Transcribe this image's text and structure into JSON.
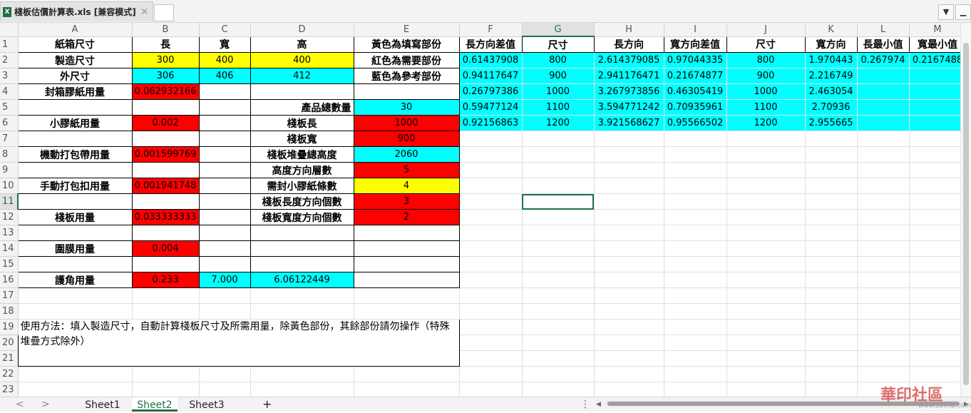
{
  "window": {
    "file_tab": "棧板估價計算表.xls  [兼容模式]",
    "file_icon": "excel-file-icon",
    "close_glyph": "✕",
    "menu_glyph": "▼",
    "minimize_glyph": "▁"
  },
  "columns": [
    "A",
    "B",
    "C",
    "D",
    "E",
    "F",
    "G",
    "H",
    "I",
    "J",
    "K",
    "L",
    "M"
  ],
  "rows": [
    "1",
    "2",
    "3",
    "4",
    "5",
    "6",
    "7",
    "8",
    "9",
    "10",
    "11",
    "12",
    "13",
    "14",
    "15",
    "16",
    "17",
    "18",
    "19",
    "20",
    "21",
    "22",
    "23"
  ],
  "selected_cell": "G11",
  "cells": {
    "A1": "紙箱尺寸",
    "B1": "長",
    "C1": "寬",
    "D1": "高",
    "E1": "黃色為填寫部份",
    "F1": "長方向差值",
    "G1": "尺寸",
    "H1": "長方向",
    "I1": "寬方向差值",
    "J1": "尺寸",
    "K1": "寬方向",
    "L1": "長最小值",
    "M1": "寬最小值",
    "A2": "製造尺寸",
    "B2": "300",
    "C2": "400",
    "D2": "400",
    "E2": "紅色為需要部份",
    "F2": "0.61437908",
    "G2": "800",
    "H2": "2.614379085",
    "I2": "0.97044335",
    "J2": "800",
    "K2": "1.970443",
    "L2": "0.267974",
    "M2": "0.2167488",
    "A3": "外尺寸",
    "B3": "306",
    "C3": "406",
    "D3": "412",
    "E3": "藍色為參考部份",
    "F3": "0.94117647",
    "G3": "900",
    "H3": "2.941176471",
    "I3": "0.21674877",
    "J3": "900",
    "K3": "2.216749",
    "A4": "封箱膠紙用量",
    "B4": "0.062932166",
    "F4": "0.26797386",
    "G4": "1000",
    "H4": "3.267973856",
    "I4": "0.46305419",
    "J4": "1000",
    "K4": "2.463054",
    "D5": "產品總數量",
    "E5": "30",
    "F5": "0.59477124",
    "G5": "1100",
    "H5": "3.594771242",
    "I5": "0.70935961",
    "J5": "1100",
    "K5": "2.70936",
    "A6": "小膠紙用量",
    "B6": "0.002",
    "D6": "棧板長",
    "E6": "1000",
    "F6": "0.92156863",
    "G6": "1200",
    "H6": "3.921568627",
    "I6": "0.95566502",
    "J6": "1200",
    "K6": "2.955665",
    "D7": "棧板寬",
    "E7": "900",
    "A8": "機動打包帶用量",
    "B8": "0.001599769",
    "D8": "棧板堆疊總高度",
    "E8": "2060",
    "D9": "高度方向層數",
    "E9": "5",
    "A10": "手動打包扣用量",
    "B10": "0.001941748",
    "D10": "需封小膠紙條數",
    "E10": "4",
    "D11": "棧板長度方向個數",
    "E11": "3",
    "A12": "棧板用量",
    "B12": "0.033333333",
    "D12": "棧板寬度方向個數",
    "E12": "2",
    "A14": "圍膜用量",
    "B14": "0.004",
    "A16": "護角用量",
    "B16": "0.233",
    "C16": "7.000",
    "D16": "6.06122449",
    "A19": "使用方法：填入製造尺寸，自動計算棧板尺寸及所需用量，除黃色部份，其餘部份請勿操作（特殊堆疊方式除外）"
  },
  "sheet_tabs": [
    "Sheet1",
    "Sheet2",
    "Sheet3"
  ],
  "active_sheet": "Sheet2",
  "add_sheet_glyph": "+",
  "nav_prev_glyph": "<",
  "nav_next_glyph": ">",
  "more_glyph": "⋮",
  "scroll_left_glyph": "◀",
  "scroll_right_glyph": "▶",
  "watermark": "華印社區",
  "watermark_url": "www.52cnp.com",
  "colors": {
    "yellow": "#ffff00",
    "cyan": "#00ffff",
    "red": "#ff0000",
    "accent": "#1f7244"
  }
}
